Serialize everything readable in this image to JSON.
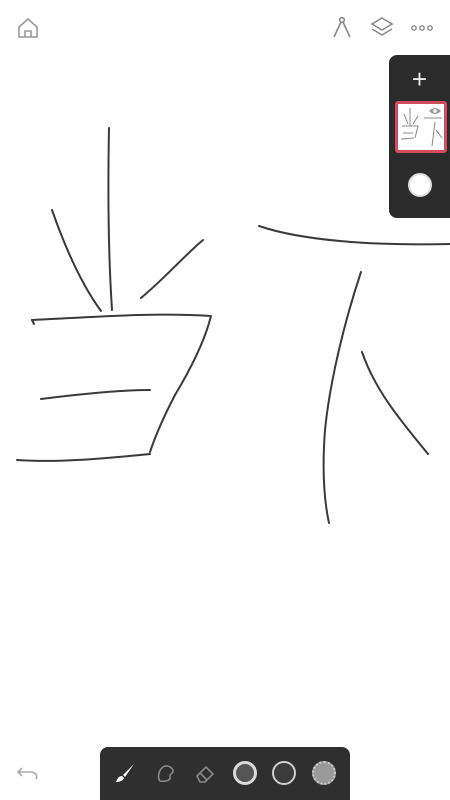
{
  "icons": {
    "home": "home-icon",
    "ruler": "ruler-compass-icon",
    "layers": "layers-icon",
    "more": "more-icon",
    "add": "+",
    "eye": "eye-icon",
    "undo": "undo-icon",
    "brush": "brush-icon",
    "smudge": "smudge-icon",
    "eraser": "eraser-icon"
  },
  "colors": {
    "panel_bg": "#2b2b2b",
    "toolbar_bg": "#2f2f2f",
    "selected_layer_border": "#d24c5b",
    "stroke": "#3a3a3a"
  },
  "layers_panel": {
    "add_label": "+",
    "layers": [
      {
        "type": "drawing",
        "selected": true,
        "visible": true
      },
      {
        "type": "background",
        "color": "#ffffff"
      }
    ]
  },
  "toolbar": {
    "tools": [
      "brush",
      "smudge",
      "eraser",
      "brush-size",
      "color",
      "opacity"
    ],
    "active_tool": "brush"
  }
}
